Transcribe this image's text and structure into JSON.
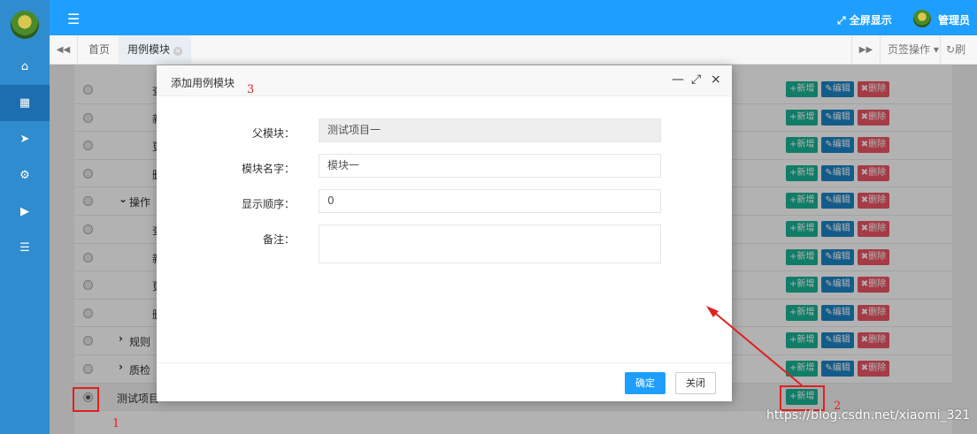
{
  "header": {
    "fullscreen_label": "全屏显示",
    "user_name": "管理员"
  },
  "sidebar": {
    "items": [
      {
        "icon": "home-icon"
      },
      {
        "icon": "grid-icon"
      },
      {
        "icon": "rocket-icon"
      },
      {
        "icon": "gear-icon"
      },
      {
        "icon": "video-icon"
      },
      {
        "icon": "list-icon"
      }
    ]
  },
  "tabs": {
    "home_label": "首页",
    "active_label": "用例模块",
    "ops_label": "页签操作",
    "refresh_label": "刷新"
  },
  "table": {
    "rows": [
      {
        "name": "查",
        "indent": 2
      },
      {
        "name": "新",
        "indent": 2
      },
      {
        "name": "更",
        "indent": 2
      },
      {
        "name": "删",
        "indent": 2
      },
      {
        "name": "操作",
        "indent": 1,
        "expanded": true
      },
      {
        "name": "查",
        "indent": 2
      },
      {
        "name": "新",
        "indent": 2
      },
      {
        "name": "更",
        "indent": 2
      },
      {
        "name": "删",
        "indent": 2
      },
      {
        "name": "规则",
        "indent": 1,
        "expanded": false
      },
      {
        "name": "质检",
        "indent": 1,
        "expanded": false
      },
      {
        "name": "测试项目一",
        "indent": 0,
        "checked": true
      }
    ],
    "add_label": "新增",
    "edit_label": "编辑",
    "delete_label": "删除"
  },
  "modal": {
    "title": "添加用例模块",
    "parent_label": "父模块：",
    "parent_value": "测试项目一",
    "name_label": "模块名字：",
    "name_value": "模块一",
    "order_label": "显示顺序：",
    "order_value": "0",
    "remark_label": "备注：",
    "remark_value": "",
    "confirm_label": "确定",
    "close_label": "关闭"
  },
  "annotations": {
    "one": "1",
    "two": "2",
    "three": "3"
  },
  "watermark": "https://blog.csdn.net/xiaomi_321",
  "colors": {
    "header": "#1e9fff",
    "sidebar": "#2f8ccf",
    "add": "#1ab394",
    "edit": "#1c84c6",
    "delete": "#ed5565",
    "annotation": "#e02020"
  }
}
